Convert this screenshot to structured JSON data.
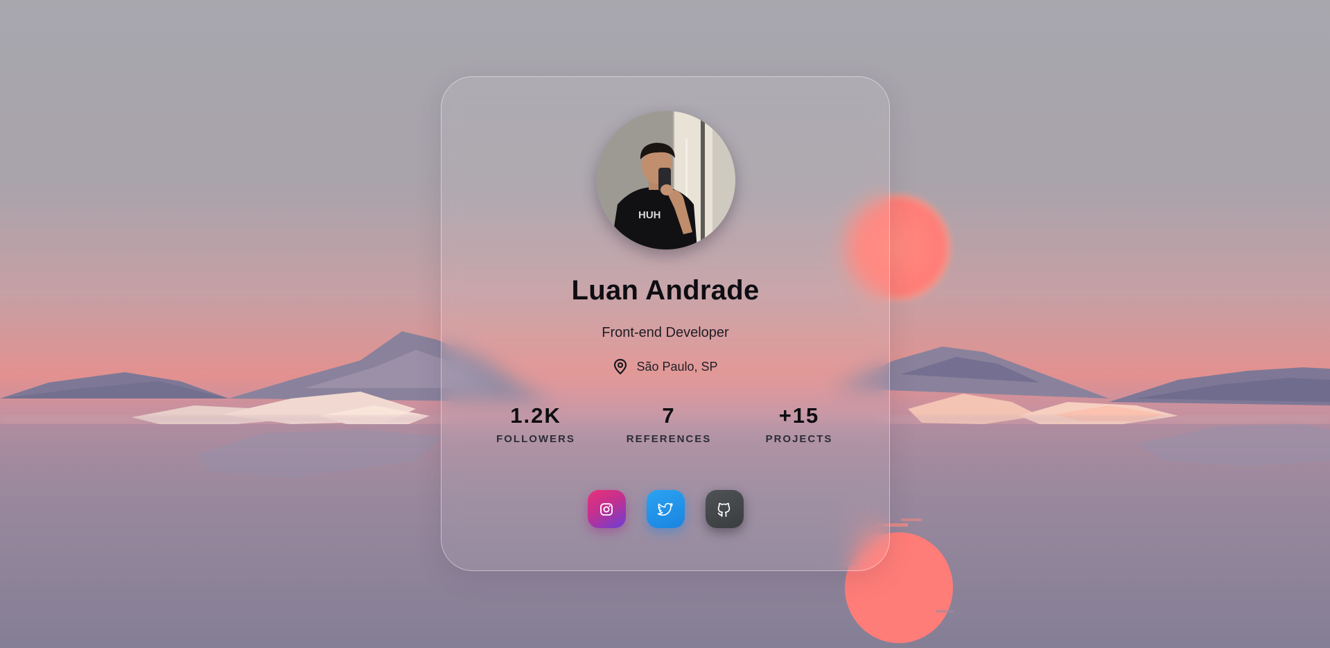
{
  "profile": {
    "name": "Luan Andrade",
    "role": "Front-end Developer",
    "location": "São Paulo, SP",
    "avatar_alt": "profile photo"
  },
  "stats": [
    {
      "value": "1.2K",
      "label": "FOLLOWERS"
    },
    {
      "value": "7",
      "label": "REFERENCES"
    },
    {
      "value": "+15",
      "label": "PROJECTS"
    }
  ],
  "socials": [
    {
      "name": "Instagram",
      "icon": "instagram-icon",
      "color": "#d5317f"
    },
    {
      "name": "Twitter",
      "icon": "twitter-icon",
      "color": "#1d8fe8"
    },
    {
      "name": "GitHub",
      "icon": "github-icon",
      "color": "#46494b"
    }
  ],
  "colors": {
    "sky_top": "#a9a8af",
    "horizon": "#e8908f",
    "sun": "#ff7f78",
    "water": "#8a8396"
  }
}
